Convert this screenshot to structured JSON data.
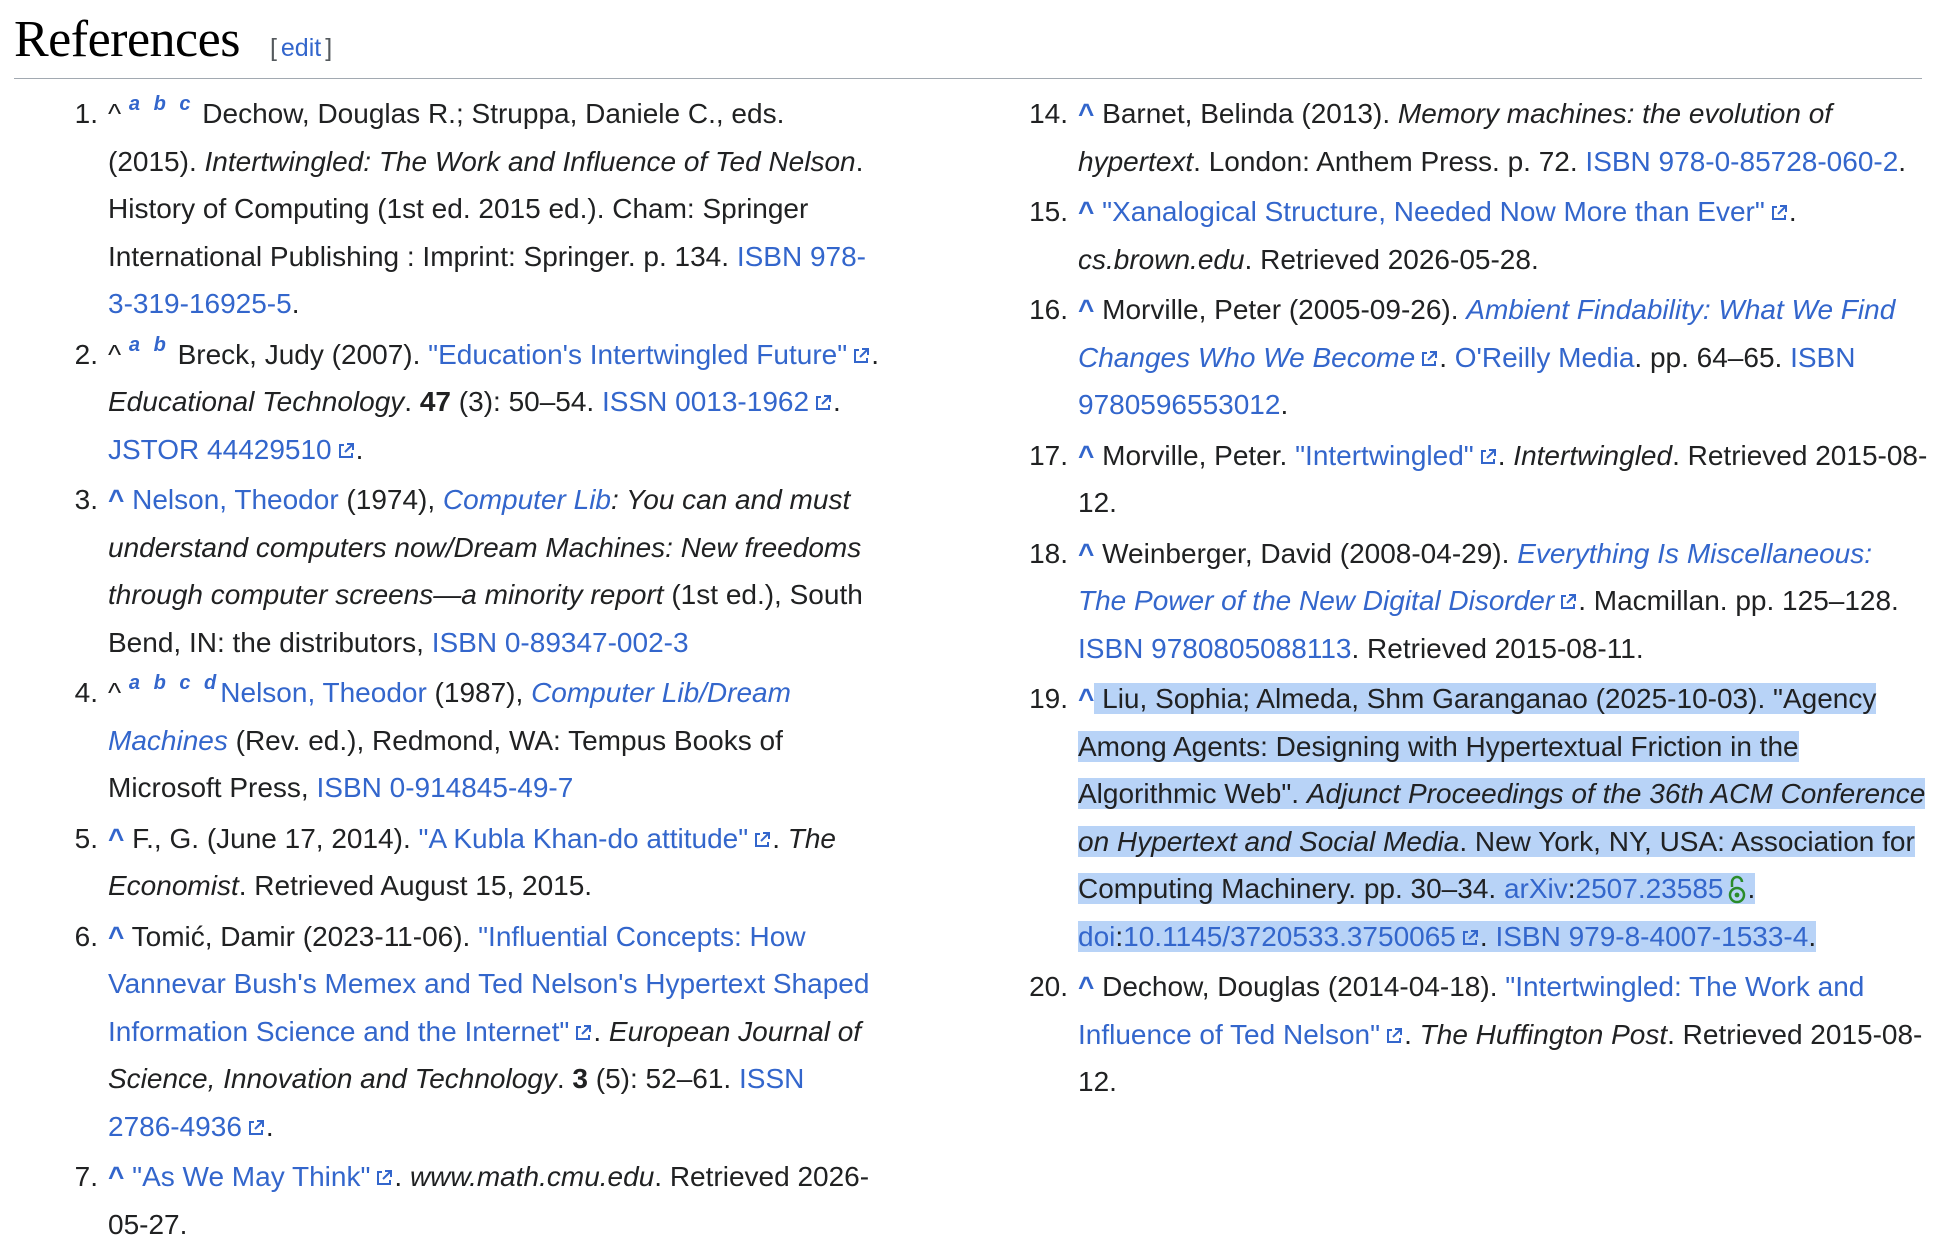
{
  "heading": {
    "title": "References",
    "edit_label": "edit",
    "bracket_open": "[",
    "bracket_close": "]"
  },
  "colors": {
    "link": "#3366cc",
    "highlight": "#b8d3f7",
    "open_access": "#2a8c2a",
    "text": "#202122"
  },
  "icons": {
    "external": "external-link-icon",
    "open_access": "open-access-lock-icon"
  },
  "references": [
    {
      "num": "1.",
      "caret": "^",
      "backlinks": "a b c",
      "authors": " Dechow, Douglas R.; Struppa, Daniele C., eds. (2015). ",
      "title": "Intertwingled: The Work and Influence of Ted Nelson",
      "rest": ". History of Computing (1st ed. 2015 ed.). Cham: Springer International Publishing : Imprint: Springer. p. 134. ",
      "isbn": "ISBN 978-3-319-16925-5",
      "end": "."
    },
    {
      "num": "2.",
      "caret": "^",
      "backlinks": "a b",
      "authors": " Breck, Judy (2007). ",
      "link": "\"Education's Intertwingled Future\"",
      "sep": ". ",
      "journal": "Educational Technology",
      "sep2": ". ",
      "vol": "47",
      "pages": " (3): 50–54. ",
      "issn": "ISSN 0013-1962",
      "sep3": ". ",
      "jstor": "JSTOR 44429510",
      "end": "."
    },
    {
      "num": "3.",
      "caret": "^",
      "author_link": "Nelson, Theodor",
      "year": " (1974), ",
      "title_link": "Computer Lib",
      "title_rest": ": You can and must understand computers now/Dream Machines: New freedoms through computer screens—a minority report",
      "rest": " (1st ed.), South Bend, IN: the distributors, ",
      "isbn": "ISBN 0-89347-002-3"
    },
    {
      "num": "4.",
      "caret": "^",
      "backlinks": "a b c d",
      "author_link": "Nelson, Theodor",
      "year": " (1987), ",
      "title_link": "Computer Lib/Dream Machines",
      "rest": " (Rev. ed.), Redmond, WA: Tempus Books of Microsoft Press, ",
      "isbn": "ISBN 0-914845-49-7"
    },
    {
      "num": "5.",
      "caret": "^",
      "authors": " F., G. (June 17, 2014). ",
      "link": "\"A Kubla Khan-do attitude\"",
      "sep": ". ",
      "journal": "The Economist",
      "rest": ". Retrieved August 15, 2015."
    },
    {
      "num": "6.",
      "caret": "^",
      "authors": " Tomić, Damir (2023-11-06). ",
      "link": "\"Influential Concepts: How Vannevar Bush's Memex and Ted Nelson's Hypertext Shaped Information Science and the Internet\"",
      "sep": ". ",
      "journal": "European Journal of Science, Innovation and Technology",
      "sep2": ". ",
      "vol": "3",
      "pages": " (5): 52–61. ",
      "issn": "ISSN 2786-4936",
      "end": "."
    },
    {
      "num": "7.",
      "caret": "^",
      "link": "\"As We May Think\"",
      "sep": ". ",
      "site": "www.math.cmu.edu",
      "rest": ". Retrieved 2026-05-27."
    },
    {
      "num": "14.",
      "caret": "^",
      "authors": " Barnet, Belinda (2013). ",
      "title": "Memory machines: the evolution of hypertext",
      "rest": ". London: Anthem Press. p. 72. ",
      "isbn": "ISBN 978-0-85728-060-2",
      "end": "."
    },
    {
      "num": "15.",
      "caret": "^",
      "link": "\"Xanalogical Structure, Needed Now More than Ever\"",
      "sep": ". ",
      "site": "cs.brown.edu",
      "rest": ". Retrieved 2026-05-28."
    },
    {
      "num": "16.",
      "caret": "^",
      "authors": " Morville, Peter (2005-09-26). ",
      "title_link": "Ambient Findability: What We Find Changes Who We Become",
      "sep": ". ",
      "publisher_link": "O'Reilly Media",
      "rest": ". pp. 64–65. ",
      "isbn": "ISBN 9780596553012",
      "end": "."
    },
    {
      "num": "17.",
      "caret": "^",
      "authors": " Morville, Peter. ",
      "link": "\"Intertwingled\"",
      "sep": ". ",
      "site": "Intertwingled",
      "rest": ". Retrieved 2015-08-12."
    },
    {
      "num": "18.",
      "caret": "^",
      "authors": " Weinberger, David (2008-04-29). ",
      "title_link": "Everything Is Miscellaneous: The Power of the New Digital Disorder",
      "rest": ". Macmillan. pp. 125–128. ",
      "isbn": "ISBN 9780805088113",
      "end": ". Retrieved 2015-08-11."
    },
    {
      "num": "19.",
      "caret": "^",
      "authors": " Liu, Sophia; Almeda, Shm Garanganao (2025-10-03). \"Agency Among Agents: Designing with Hypertextual Friction in the Algorithmic Web\". ",
      "journal": "Adjunct Proceedings of the 36th ACM Conference on Hypertext and Social Media",
      "rest": ". New York, NY, USA: Association for Computing Machinery. pp. 30–34. ",
      "arxiv_label": "arXiv",
      "arxiv_id": "2507.23585",
      "sep": ". ",
      "doi_label": "doi",
      "doi_id": "10.1145/3720533.3750065",
      "sep2": ". ",
      "isbn": "ISBN 979-8-4007-1533-4",
      "end": "."
    },
    {
      "num": "20.",
      "caret": "^",
      "authors": " Dechow, Douglas (2014-04-18). ",
      "link": "\"Intertwingled: The Work and Influence of Ted Nelson\"",
      "sep": ". ",
      "journal": "The Huffington Post",
      "rest": ". Retrieved 2015-08-12."
    }
  ]
}
